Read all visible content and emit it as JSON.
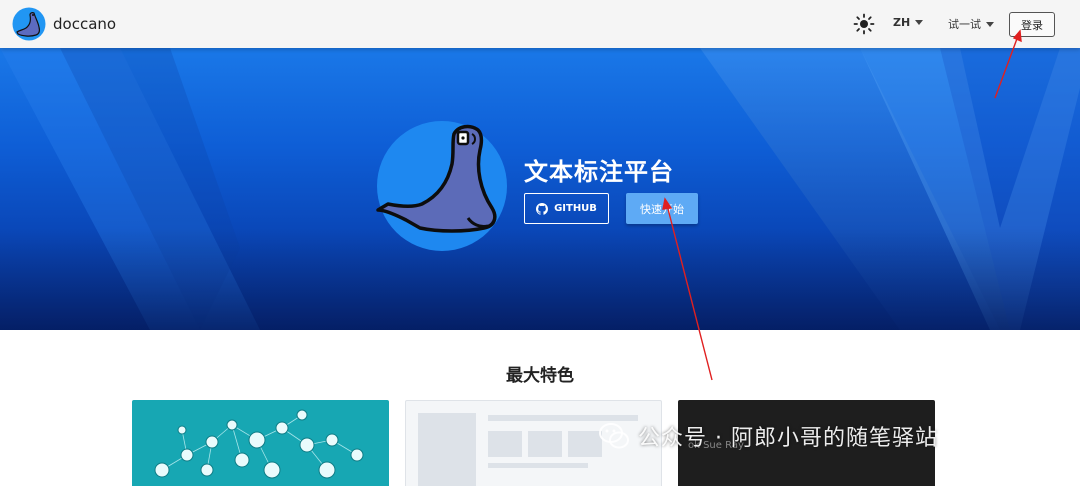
{
  "app": {
    "name": "doccano"
  },
  "nav": {
    "language": "ZH",
    "try_label": "试一试",
    "login_label": "登录"
  },
  "hero": {
    "title": "文本标注平台",
    "github_label": "GITHUB",
    "quickstart_label": "快速开始"
  },
  "features": {
    "title": "最大特色",
    "card3_text": "ok Sue Ray"
  },
  "watermark": {
    "text": "公众号 · 阿郎小哥的随笔驿站"
  },
  "colors": {
    "hero_blue": "#0e5ed6",
    "accent_button": "#5eaaf5",
    "annotation_red": "#e02020"
  }
}
